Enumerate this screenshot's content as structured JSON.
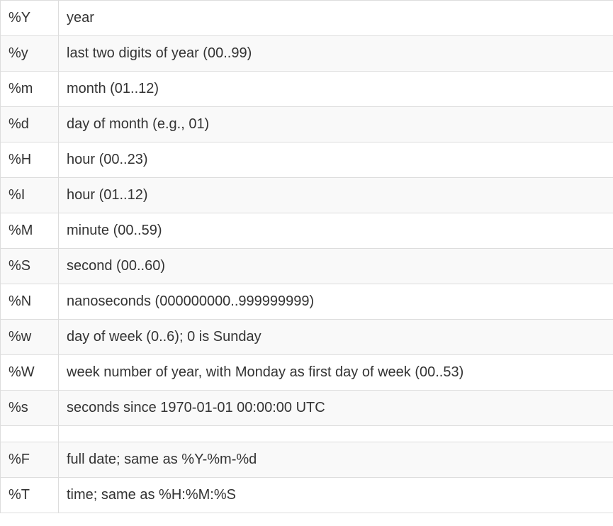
{
  "rows": [
    {
      "code": "%Y",
      "description": "year"
    },
    {
      "code": "%y",
      "description": "last two digits of year (00..99)"
    },
    {
      "code": "%m",
      "description": "month (01..12)"
    },
    {
      "code": "%d",
      "description": "day of month (e.g., 01)"
    },
    {
      "code": "%H",
      "description": "hour (00..23)"
    },
    {
      "code": "%I",
      "description": "hour (01..12)"
    },
    {
      "code": "%M",
      "description": "minute (00..59)"
    },
    {
      "code": "%S",
      "description": "second (00..60)"
    },
    {
      "code": "%N",
      "description": "nanoseconds (000000000..999999999)"
    },
    {
      "code": "%w",
      "description": "day of week (0..6); 0 is Sunday"
    },
    {
      "code": "%W",
      "description": "week number of year, with Monday as first day of week (00..53)"
    },
    {
      "code": "%s",
      "description": "seconds since 1970-01-01 00:00:00 UTC"
    },
    {
      "code": "",
      "description": ""
    },
    {
      "code": "%F",
      "description": "full date; same as %Y-%m-%d"
    },
    {
      "code": "%T",
      "description": "time; same as %H:%M:%S"
    }
  ]
}
